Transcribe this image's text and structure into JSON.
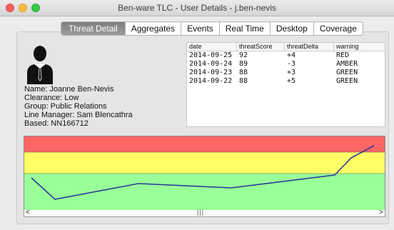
{
  "window": {
    "title": "Ben-ware TLC - User Details - j.ben-nevis"
  },
  "tabs": [
    {
      "label": "Threat Detail",
      "active": true
    },
    {
      "label": "Aggregates"
    },
    {
      "label": "Events"
    },
    {
      "label": "Real Time"
    },
    {
      "label": "Desktop"
    },
    {
      "label": "Coverage"
    }
  ],
  "user": {
    "name": "Name: Joanne Ben-Nevis",
    "clearance": "Clearance: Low",
    "group": "Group: Public Relations",
    "manager": "Line Manager: Sam Blencathra",
    "based": "Based: NN166712"
  },
  "table": {
    "columns": [
      "date",
      "threatScore",
      "threatDelta",
      "warning"
    ],
    "rows": [
      [
        "2014-09-25",
        "92",
        "+4",
        "RED"
      ],
      [
        "2014-09-24",
        "89",
        "-3",
        "AMBER"
      ],
      [
        "2014-09-23",
        "88",
        "+3",
        "GREEN"
      ],
      [
        "2014-09-22",
        "88",
        "+5",
        "GREEN"
      ]
    ]
  },
  "chart_data": {
    "type": "line",
    "bands": [
      {
        "name": "red",
        "color": "#ff6666"
      },
      {
        "name": "amber",
        "color": "#ffff66"
      },
      {
        "name": "green",
        "color": "#99ff99"
      }
    ],
    "line_color": "#2b3a9a"
  },
  "scrollbar": {
    "left_arrow": "<",
    "right_arrow": ">",
    "grip": "|||"
  }
}
